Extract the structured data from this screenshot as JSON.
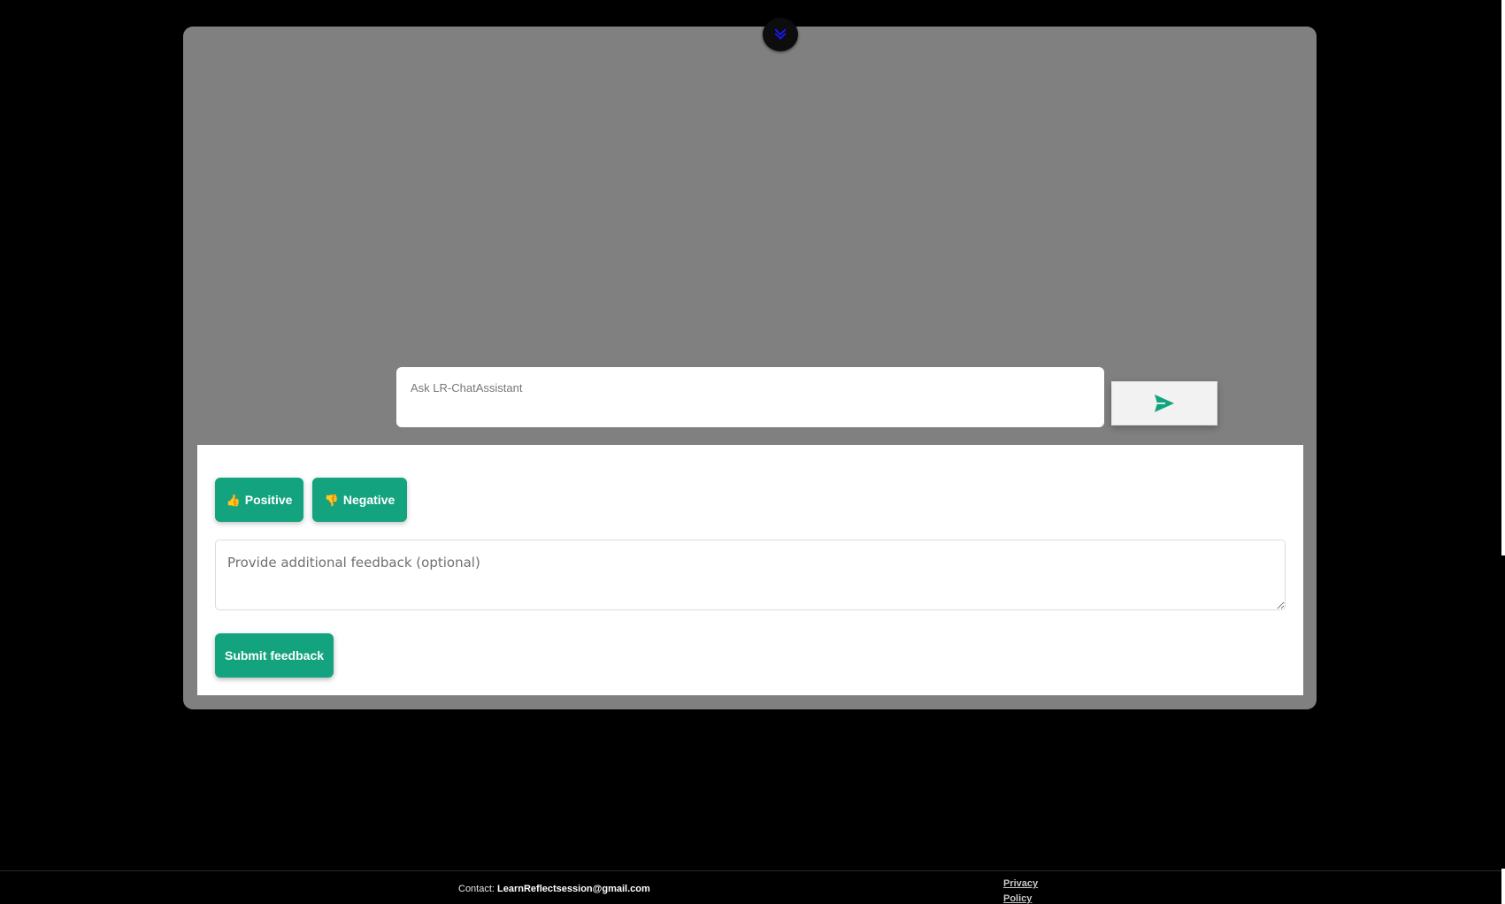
{
  "chat": {
    "input_placeholder": "Ask LR-ChatAssistant",
    "send_icon": "send-icon",
    "collapse_icon": "chevrons-down-icon"
  },
  "feedback": {
    "positive_emoji": "👍",
    "positive_label": "Positive",
    "negative_emoji": "👎",
    "negative_label": "Negative",
    "textarea_placeholder": "Provide additional feedback (optional)",
    "submit_label": "Submit feedback"
  },
  "footer": {
    "contact_label": "Contact: ",
    "contact_email": "LearnReflectsession@gmail.com",
    "privacy_label": "Privacy Policy"
  },
  "colors": {
    "page_background": "#000000",
    "panel_background": "#808080",
    "accent_green": "#14a37f",
    "toggle_chevron": "#1a1aff"
  }
}
